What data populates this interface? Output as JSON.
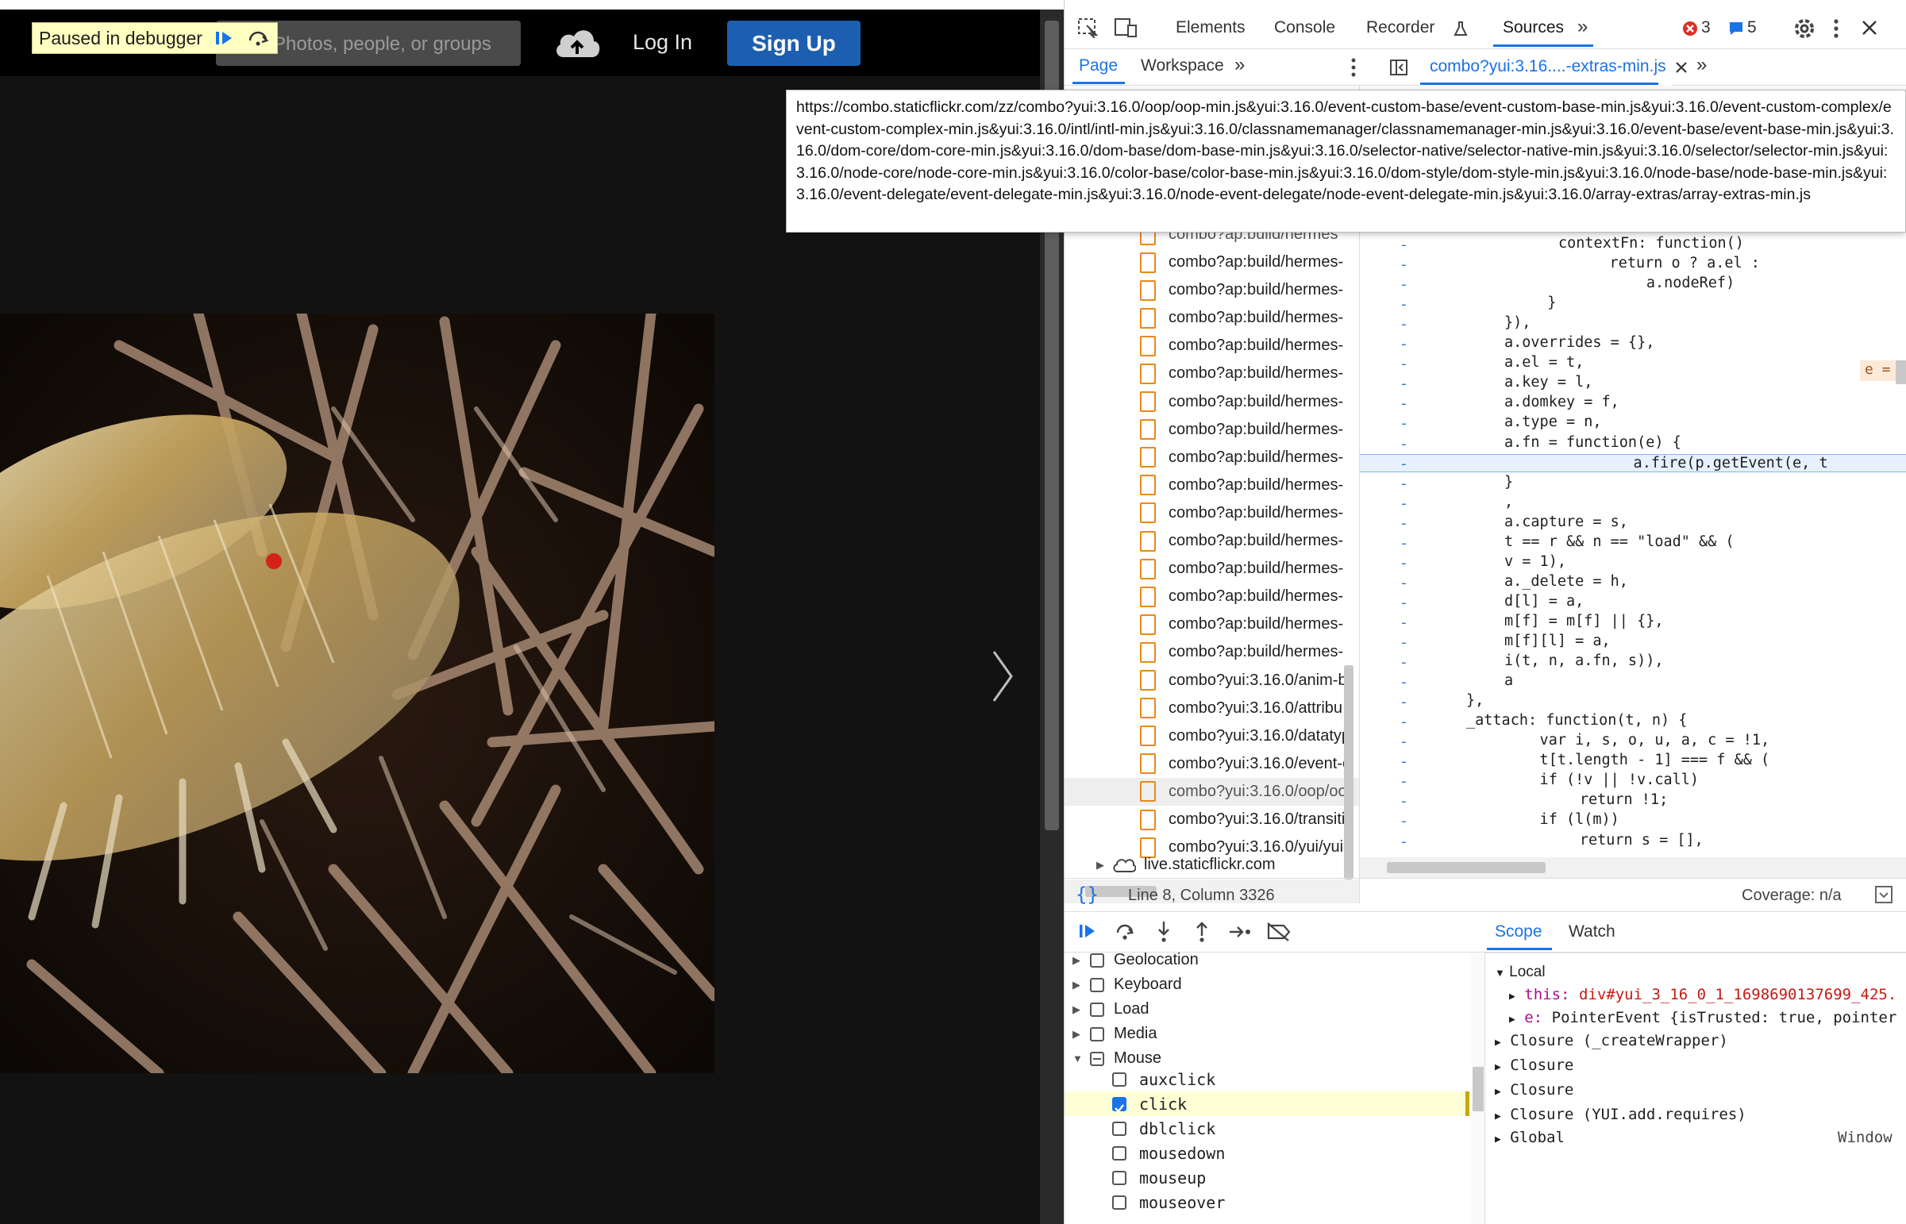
{
  "flickr": {
    "paused_label": "Paused in debugger",
    "search_placeholder": "Photos, people, or groups",
    "login_label": "Log In",
    "signup_label": "Sign Up"
  },
  "devtools": {
    "top_tabs": [
      "Elements",
      "Console",
      "Recorder",
      "Sources"
    ],
    "error_count": "3",
    "message_count": "5",
    "sub_tabs": [
      "Page",
      "Workspace"
    ],
    "open_file": "combo?yui:3.16....-extras-min.js",
    "tooltip_url": "https://combo.staticflickr.com/zz/combo?yui:3.16.0/oop/oop-min.js&yui:3.16.0/event-custom-base/event-custom-base-min.js&yui:3.16.0/event-custom-complex/event-custom-complex-min.js&yui:3.16.0/intl/intl-min.js&yui:3.16.0/classnamemanager/classnamemanager-min.js&yui:3.16.0/event-base/event-base-min.js&yui:3.16.0/dom-core/dom-core-min.js&yui:3.16.0/dom-base/dom-base-min.js&yui:3.16.0/selector-native/selector-native-min.js&yui:3.16.0/selector/selector-min.js&yui:3.16.0/node-core/node-core-min.js&yui:3.16.0/color-base/color-base-min.js&yui:3.16.0/dom-style/dom-style-min.js&yui:3.16.0/node-base/node-base-min.js&yui:3.16.0/event-delegate/event-delegate-min.js&yui:3.16.0/node-event-delegate/node-event-delegate-min.js&yui:3.16.0/array-extras/array-extras-min.js",
    "files": [
      "combo?ap:build/hermes-",
      "combo?ap:build/hermes-",
      "combo?ap:build/hermes-",
      "combo?ap:build/hermes-",
      "combo?ap:build/hermes-",
      "combo?ap:build/hermes-",
      "combo?ap:build/hermes-",
      "combo?ap:build/hermes-",
      "combo?ap:build/hermes-",
      "combo?ap:build/hermes-",
      "combo?ap:build/hermes-",
      "combo?ap:build/hermes-",
      "combo?ap:build/hermes-",
      "combo?ap:build/hermes-",
      "combo?ap:build/hermes-",
      "combo?yui:3.16.0/anim-b",
      "combo?yui:3.16.0/attribu",
      "combo?yui:3.16.0/datatyp",
      "combo?yui:3.16.0/event-c",
      "combo?yui:3.16.0/oop/oo",
      "combo?yui:3.16.0/transiti",
      "combo?yui:3.16.0/yui/yui"
    ],
    "partial_file": "combo?ap:build/hermes",
    "domain_label": "live.staticflickr.com",
    "status_position": "Line 8, Column 3326",
    "coverage": "Coverage: n/a",
    "code_lines": [
      "contextFn: function()",
      "    return o ? a.el :",
      "      a.nodeRef)",
      "  }",
      "}),",
      "a.overrides = {},",
      "a.el = t,",
      "a.key = l,",
      "a.domkey = f,",
      "a.type = n,",
      "a.fn = function(e) {",
      "    a.fire(p.getEvent(e, t",
      "}",
      ",",
      "a.capture = s,",
      "t == r && n == \"load\" && (",
      "v = 1),",
      "a._delete = h,",
      "d[l] = a,",
      "m[f] = m[f] || {},",
      "m[f][l] = a,",
      "i(t, n, a.fn, s)),",
      "a",
      "},",
      "_attach: function(t, n) {",
      "    var i, s, o, u, a, c = !1,",
      "    t[t.length - 1] === f && (",
      "    if (!v || !v.call)",
      "      return !1;",
      "    if (l(m))",
      "      return s = [],"
    ],
    "inline_value": "e =",
    "breakpoint_groups": [
      "Geolocation",
      "Keyboard",
      "Load",
      "Media",
      "Mouse"
    ],
    "mouse_events": [
      "auxclick",
      "click",
      "dblclick",
      "mousedown",
      "mouseup",
      "mouseover"
    ],
    "scope_tabs": [
      "Scope",
      "Watch"
    ],
    "scope": {
      "local": "Local",
      "this_label": "this:",
      "this_value": "div#yui_3_16_0_1_1698690137699_425.",
      "e_label": "e:",
      "e_value": "PointerEvent {isTrusted: true, pointer",
      "closures": [
        "Closure (_createWrapper)",
        "Closure",
        "Closure",
        "Closure (YUI.add.requires)"
      ],
      "global": "Global",
      "global_value": "Window"
    }
  },
  "colors": {
    "accent": "#1a73e8",
    "signup": "#1c5fb0",
    "file_icon": "#e8891a"
  }
}
